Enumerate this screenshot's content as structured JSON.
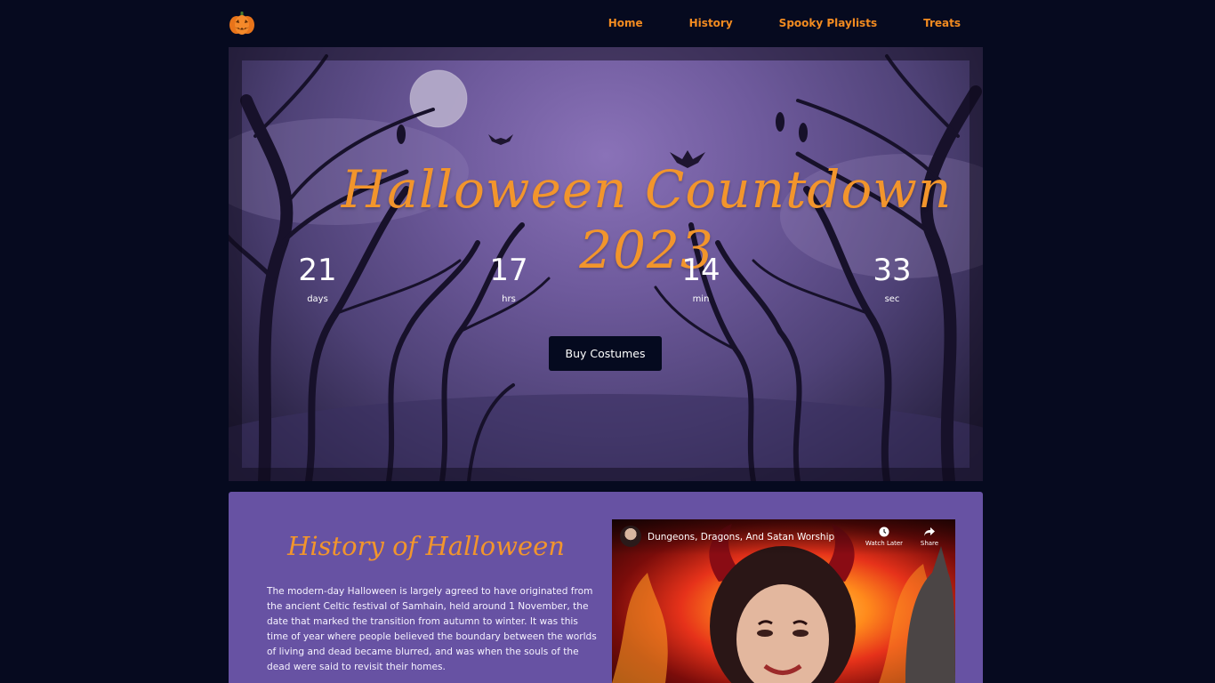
{
  "nav": {
    "logo": "pumpkin-icon",
    "links": [
      "Home",
      "History",
      "Spooky Playlists",
      "Treats"
    ]
  },
  "hero": {
    "title": "Halloween Countdown 2023",
    "countdown": [
      {
        "value": "21",
        "label": "days"
      },
      {
        "value": "17",
        "label": "hrs"
      },
      {
        "value": "14",
        "label": "min"
      },
      {
        "value": "33",
        "label": "sec"
      }
    ],
    "button": "Buy Costumes"
  },
  "history": {
    "title": "History of Halloween",
    "paragraph": "The modern-day Halloween is largely agreed to have originated from the ancient Celtic festival of Samhain, held around 1 November, the date that marked the transition from autumn to winter. It was this time of year where people believed the boundary between the worlds of living and dead became blurred, and was when the souls of the dead were said to revisit their homes.",
    "video": {
      "title": "Dungeons, Dragons, And Satan Worship",
      "watch_later": "Watch Later",
      "share": "Share"
    }
  },
  "colors": {
    "background": "#060a1f",
    "accent": "#f28b20",
    "history_bg": "#6752a3"
  }
}
